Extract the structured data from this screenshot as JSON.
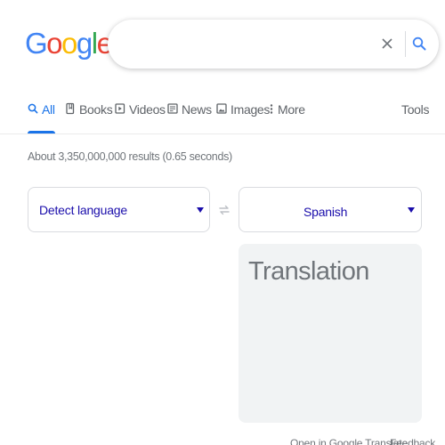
{
  "logo": {
    "letters": [
      "G",
      "o",
      "o",
      "g",
      "l",
      "e"
    ],
    "colors": [
      "#4285F4",
      "#EA4335",
      "#FBBC05",
      "#4285F4",
      "#34A853",
      "#EA4335"
    ]
  },
  "search": {
    "value": "",
    "clear_icon": "close-icon",
    "search_icon": "search-icon"
  },
  "tabs": [
    {
      "label": "All",
      "icon": "search-icon",
      "active": true
    },
    {
      "label": "Books",
      "icon": "book-icon",
      "active": false
    },
    {
      "label": "Videos",
      "icon": "play-icon",
      "active": false
    },
    {
      "label": "News",
      "icon": "newspaper-icon",
      "active": false
    },
    {
      "label": "Images",
      "icon": "image-icon",
      "active": false
    },
    {
      "label": "More",
      "icon": "more-vert-icon",
      "active": false
    }
  ],
  "tools_label": "Tools",
  "result_stats": "About 3,350,000,000 results (0.65 seconds)",
  "translate": {
    "source_language": "Detect language",
    "target_language": "Spanish",
    "placeholder": "Translation",
    "swap_icon": "swap-icon"
  },
  "footer": {
    "open_link": "Open in Google Translate",
    "feedback": "Feedback"
  },
  "colors": {
    "accent": "#1a73e8",
    "link": "#1a0dab",
    "muted": "#70757a",
    "panel": "#f1f3f4",
    "border": "#dadce0"
  }
}
